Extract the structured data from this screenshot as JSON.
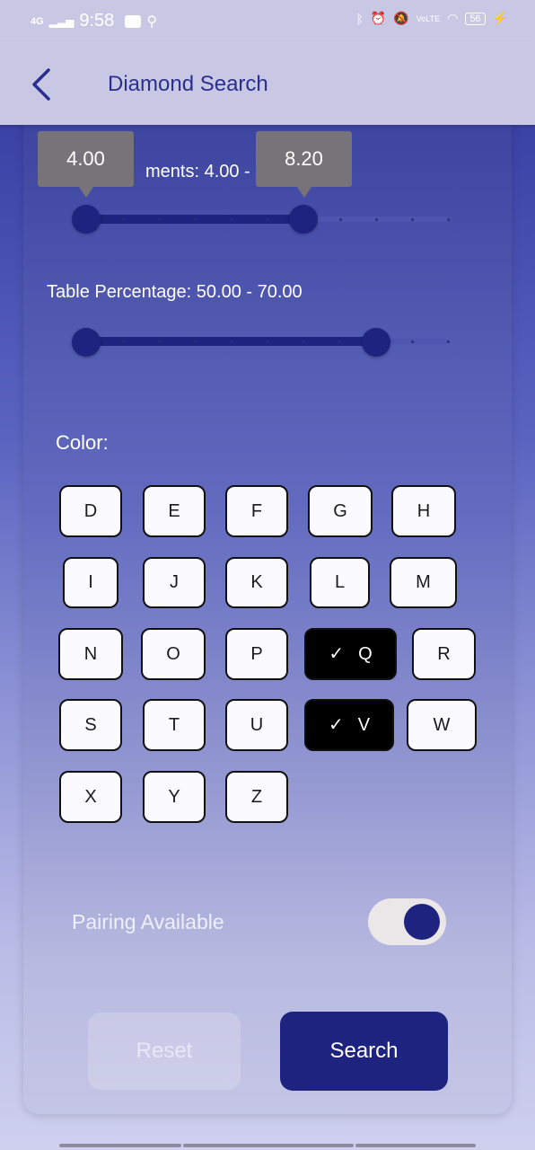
{
  "status_bar": {
    "network": "4G",
    "time": "9:58",
    "battery": "56"
  },
  "header": {
    "title": "Diamond Search"
  },
  "measurements": {
    "label_partial": "ments: 4.00 -",
    "min_tooltip": "4.00",
    "max_tooltip": "8.20",
    "range_fraction": [
      0.0,
      0.58
    ]
  },
  "table_percentage": {
    "label": "Table Percentage: 50.00 - 70.00",
    "range_fraction": [
      0.0,
      0.8
    ]
  },
  "color": {
    "label": "Color:",
    "options": [
      "D",
      "E",
      "F",
      "G",
      "H",
      "I",
      "J",
      "K",
      "L",
      "M",
      "N",
      "O",
      "P",
      "Q",
      "R",
      "S",
      "T",
      "U",
      "V",
      "W",
      "X",
      "Y",
      "Z"
    ],
    "selected": [
      "Q",
      "V"
    ],
    "check_glyph": "✓"
  },
  "pairing": {
    "label": "Pairing Available",
    "enabled": true
  },
  "actions": {
    "reset_label": "Reset",
    "search_label": "Search"
  },
  "colors": {
    "accent": "#1d237f",
    "header_bg": "#c8c8e4",
    "header_text": "#2a2f8e",
    "tooltip_bg": "#767478"
  }
}
